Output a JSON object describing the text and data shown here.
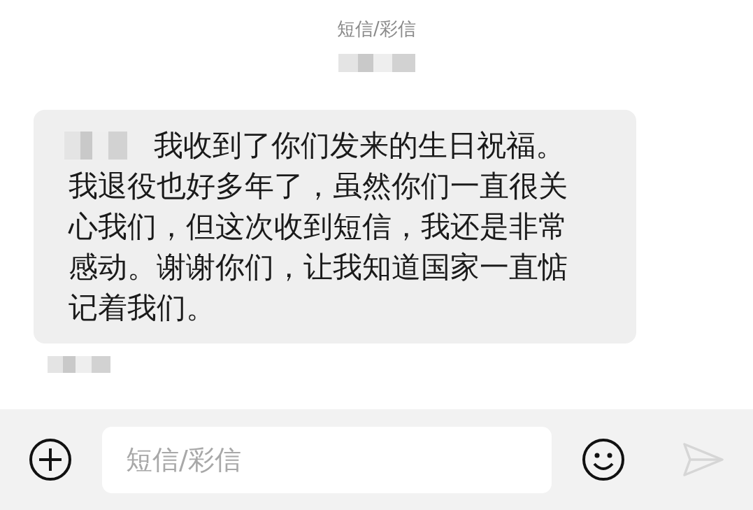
{
  "header": {
    "title": "短信/彩信"
  },
  "messages": [
    {
      "greeting": "我收到了你们发来的生日祝福。",
      "text": "我退役也好多年了，虽然你们一直很关心我们，但这次收到短信，我还是非常感动。谢谢你们，让我知道国家一直惦记着我们。"
    }
  ],
  "composer": {
    "placeholder": "短信/彩信",
    "send_disabled": true
  }
}
